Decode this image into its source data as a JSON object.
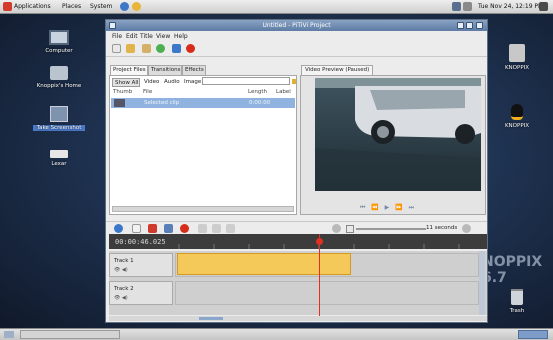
{
  "top_panel": {
    "menus": [
      "Applications",
      "Places",
      "System"
    ],
    "clock": "Tue Nov 24, 12:19 PM"
  },
  "desktop": {
    "left_icons": [
      {
        "label": "Computer",
        "icon": "computer-icon"
      },
      {
        "label": "Knoppix's Home",
        "icon": "home-folder-icon"
      },
      {
        "label": "Take Screenshot",
        "icon": "screenshot-icon",
        "selected": true
      },
      {
        "label": "Lexar",
        "icon": "drive-icon"
      }
    ],
    "right_icons": [
      {
        "label": "KNOPPIX",
        "icon": "disc-icon"
      },
      {
        "label": "KNOPPIX",
        "icon": "tux-penguin-icon"
      },
      {
        "label": "Trash",
        "icon": "trash-icon"
      }
    ],
    "watermark": "NOPPIX 6.7"
  },
  "window": {
    "title": "Untitled - PiTiVi Project",
    "menu": [
      "File",
      "Edit",
      "Title",
      "View",
      "Help"
    ],
    "tabs": [
      {
        "label": "Project Files",
        "active": true
      },
      {
        "label": "Transitions",
        "active": false
      },
      {
        "label": "Effects",
        "active": false
      }
    ],
    "filters": [
      "Show All",
      "Video",
      "Audio",
      "Image"
    ],
    "columns": [
      "Thumb",
      "File",
      "Length",
      "Label"
    ],
    "file": {
      "name": "Selected clip",
      "length": "0:00:00"
    },
    "preview_label": "Video Preview (Paused)",
    "preview_controls": "⏮ ⏪ ▶ ⏩ ⏭",
    "zoom_label": "11 seconds",
    "timecode": "00:00:46.025",
    "tracks": [
      "Track 1",
      "Track 2"
    ],
    "track_icons": "👁 ◀)"
  }
}
